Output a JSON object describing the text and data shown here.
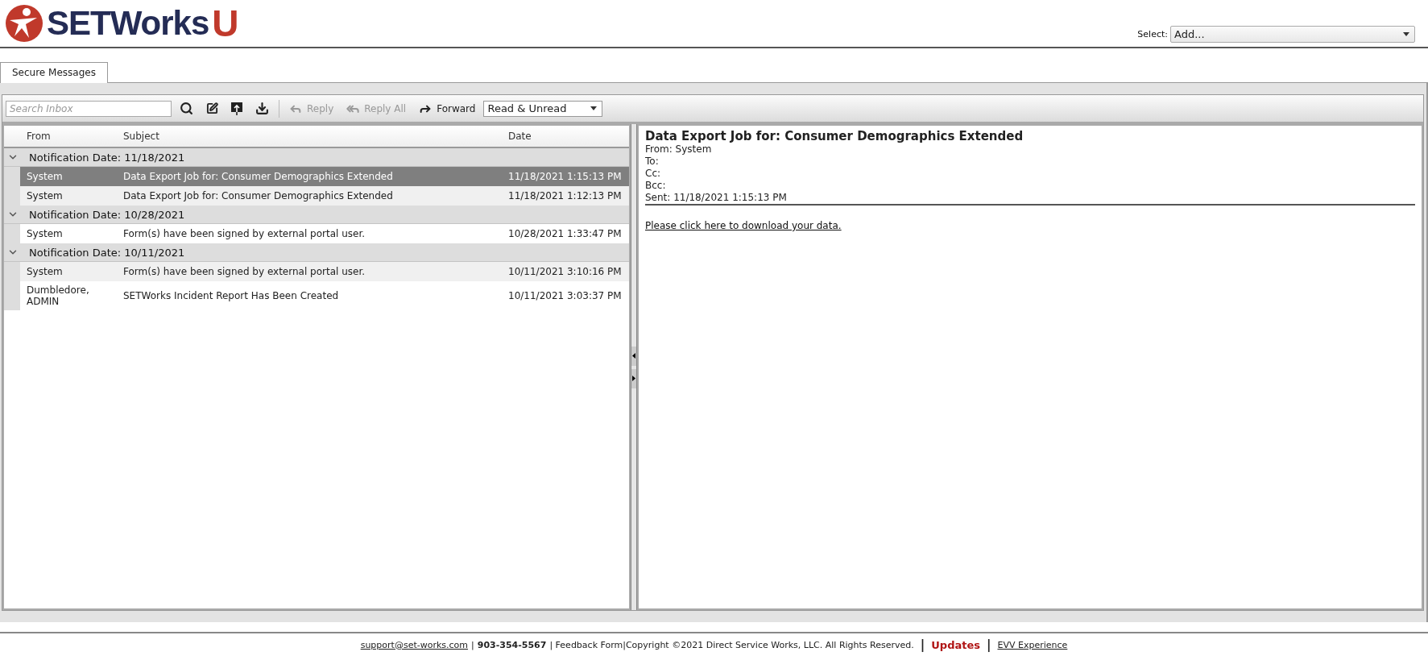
{
  "header": {
    "logo_text": "SETWorks",
    "logo_accent": "U",
    "select_label": "Select:",
    "select_value": "Add..."
  },
  "tabs": [
    {
      "label": "Secure Messages",
      "selected": true
    }
  ],
  "toolbar": {
    "search": {
      "placeholder": "Search Inbox"
    },
    "buttons": [
      {
        "kind": "search"
      },
      {
        "kind": "compose"
      },
      {
        "kind": "upload"
      },
      {
        "kind": "download"
      },
      {
        "kind": "reply",
        "label": "Reply",
        "disabled": true
      },
      {
        "kind": "reply_all",
        "label": "Reply All",
        "disabled": true
      },
      {
        "kind": "forward",
        "label": "Forward",
        "disabled": false
      }
    ],
    "filter": "Read & Unread"
  },
  "message_list": {
    "columns": [
      "From",
      "Subject",
      "Date"
    ],
    "groups": [
      {
        "label": "Notification Date: 11/18/2021",
        "expanded": true,
        "messages": [
          {
            "from": "System",
            "subject": "Data Export Job for: Consumer Demographics Extended",
            "date": "11/18/2021 1:15:13 PM",
            "selected": true
          },
          {
            "from": "System",
            "subject": "Data Export Job for: Consumer Demographics Extended",
            "date": "11/18/2021 1:12:13 PM",
            "selected": false
          }
        ]
      },
      {
        "label": "Notification Date: 10/28/2021",
        "expanded": true,
        "messages": [
          {
            "from": "System",
            "subject": "Form(s) have been signed by external portal user.",
            "date": "10/28/2021 1:33:47 PM",
            "selected": false
          }
        ]
      },
      {
        "label": "Notification Date: 10/11/2021",
        "expanded": true,
        "messages": [
          {
            "from": "System",
            "subject": "Form(s) have been signed by external portal user.",
            "date": "10/11/2021 3:10:16 PM",
            "selected": false
          },
          {
            "from": "Dumbledore, ADMIN",
            "subject": "SETWorks Incident Report Has Been Created",
            "date": "10/11/2021 3:03:37 PM",
            "selected": false
          }
        ]
      }
    ]
  },
  "reading_pane": {
    "title": "Data Export Job for: Consumer Demographics Extended",
    "fields": [
      "From: System",
      "To:",
      "Cc:",
      "Bcc:",
      "Sent: 11/18/2021 1:15:13 PM"
    ],
    "link": "Please click here to download your data."
  },
  "footer": [
    {
      "kind": "link",
      "text": "support@set-works.com"
    },
    {
      "kind": "plain",
      "text": "|"
    },
    {
      "kind": "bold",
      "text": "903-354-5567"
    },
    {
      "kind": "plain",
      "text": "| Feedback Form|Copyright ©2021 Direct Service Works, LLC. All Rights Reserved."
    },
    {
      "kind": "separator",
      "text": "|"
    },
    {
      "kind": "highlight",
      "text": "Updates"
    },
    {
      "kind": "separator",
      "text": "|"
    },
    {
      "kind": "link",
      "text": "EVV Experience"
    }
  ]
}
